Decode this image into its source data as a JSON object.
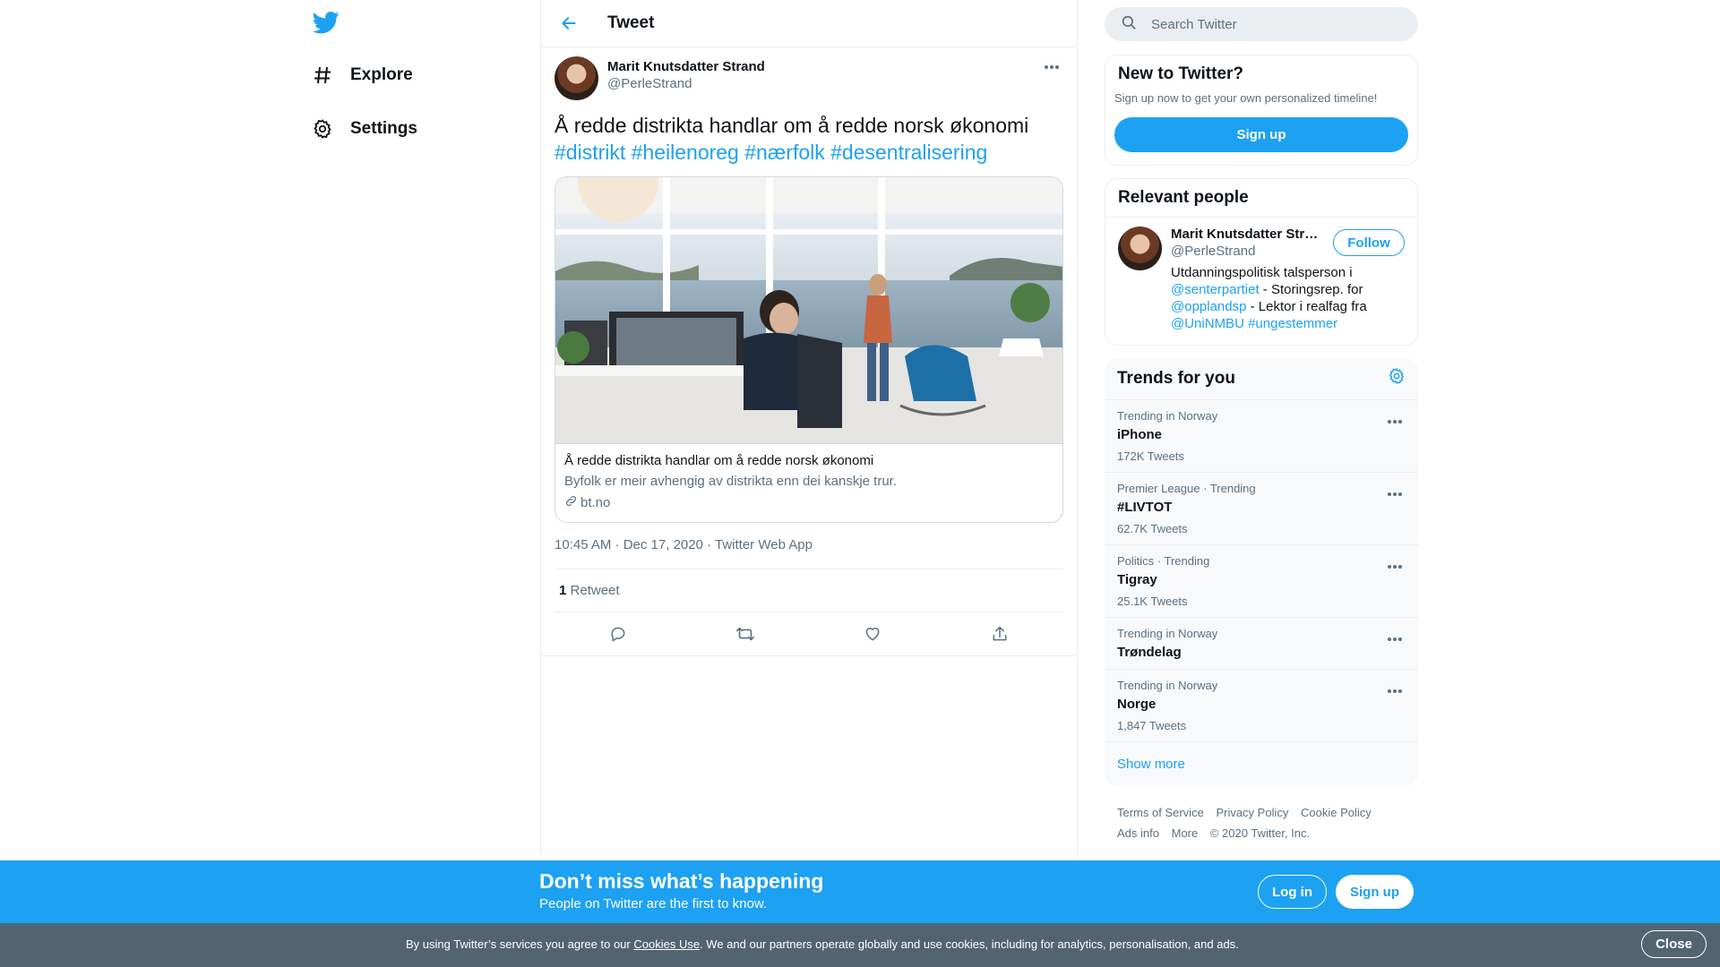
{
  "nav": {
    "logo_icon": "twitter-bird-icon",
    "items": [
      {
        "label": "Explore",
        "icon": "hashtag-icon"
      },
      {
        "label": "Settings",
        "icon": "gear-icon"
      }
    ]
  },
  "header": {
    "title": "Tweet"
  },
  "tweet": {
    "author_name": "Marit Knutsdatter Strand",
    "author_handle": "@PerleStrand",
    "text": "Å redde distrikta handlar om å redde norsk økonomi",
    "hashtags": [
      "#distrikt",
      "#heilenoreg",
      "#nærfolk",
      "#desentralisering"
    ],
    "card": {
      "title": "Å redde distrikta handlar om å redde norsk økonomi",
      "description": "Byfolk er meir avhengig av distrikta enn dei kanskje trur.",
      "domain": "bt.no"
    },
    "timestamp": "10:45 AM · Dec 17, 2020",
    "separator": " · ",
    "source": "Twitter Web App",
    "retweet_count": "1",
    "retweet_label": "Retweet"
  },
  "sidebar": {
    "search_placeholder": "Search Twitter",
    "new_to_twitter": {
      "title": "New to Twitter?",
      "subtitle": "Sign up now to get your own personalized timeline!",
      "button": "Sign up"
    },
    "relevant_people": {
      "title": "Relevant people",
      "name": "Marit Knutsdatter Strand",
      "handle": "@PerleStrand",
      "follow": "Follow",
      "bio": {
        "p1": "Utdanningspolitisk talsperson i ",
        "m1": "@senterpartiet",
        "p2": " - Storingsrep. for ",
        "m2": "@opplandsp",
        "p3": " - Lektor i realfag fra ",
        "m3": "@UniNMBU",
        "m4": " #ungestemmer"
      }
    },
    "trends": {
      "title": "Trends for you",
      "items": [
        {
          "context": "Trending in Norway",
          "name": "iPhone",
          "count": "172K Tweets"
        },
        {
          "context": "Premier League · Trending",
          "name": "#LIVTOT",
          "count": "62.7K Tweets"
        },
        {
          "context": "Politics · Trending",
          "name": "Tigray",
          "count": "25.1K Tweets"
        },
        {
          "context": "Trending in Norway",
          "name": "Trøndelag",
          "count": ""
        },
        {
          "context": "Trending in Norway",
          "name": "Norge",
          "count": "1,847 Tweets"
        }
      ],
      "show_more": "Show more"
    },
    "footer": {
      "terms": "Terms of Service",
      "privacy": "Privacy Policy",
      "cookie": "Cookie Policy",
      "ads": "Ads info",
      "more": "More",
      "copyright": "© 2020 Twitter, Inc."
    }
  },
  "banner": {
    "title": "Don’t miss what’s happening",
    "subtitle": "People on Twitter are the first to know.",
    "login": "Log in",
    "signup": "Sign up"
  },
  "cookie_bar": {
    "prefix": "By using Twitter’s services you agree to our ",
    "link": "Cookies Use",
    "suffix": ". We and our partners operate globally and use cookies, including for analytics, personalisation, and ads.",
    "close": "Close"
  },
  "colors": {
    "accent": "#1da1f2",
    "muted": "#5b7083",
    "cookie_bg": "#536471"
  }
}
